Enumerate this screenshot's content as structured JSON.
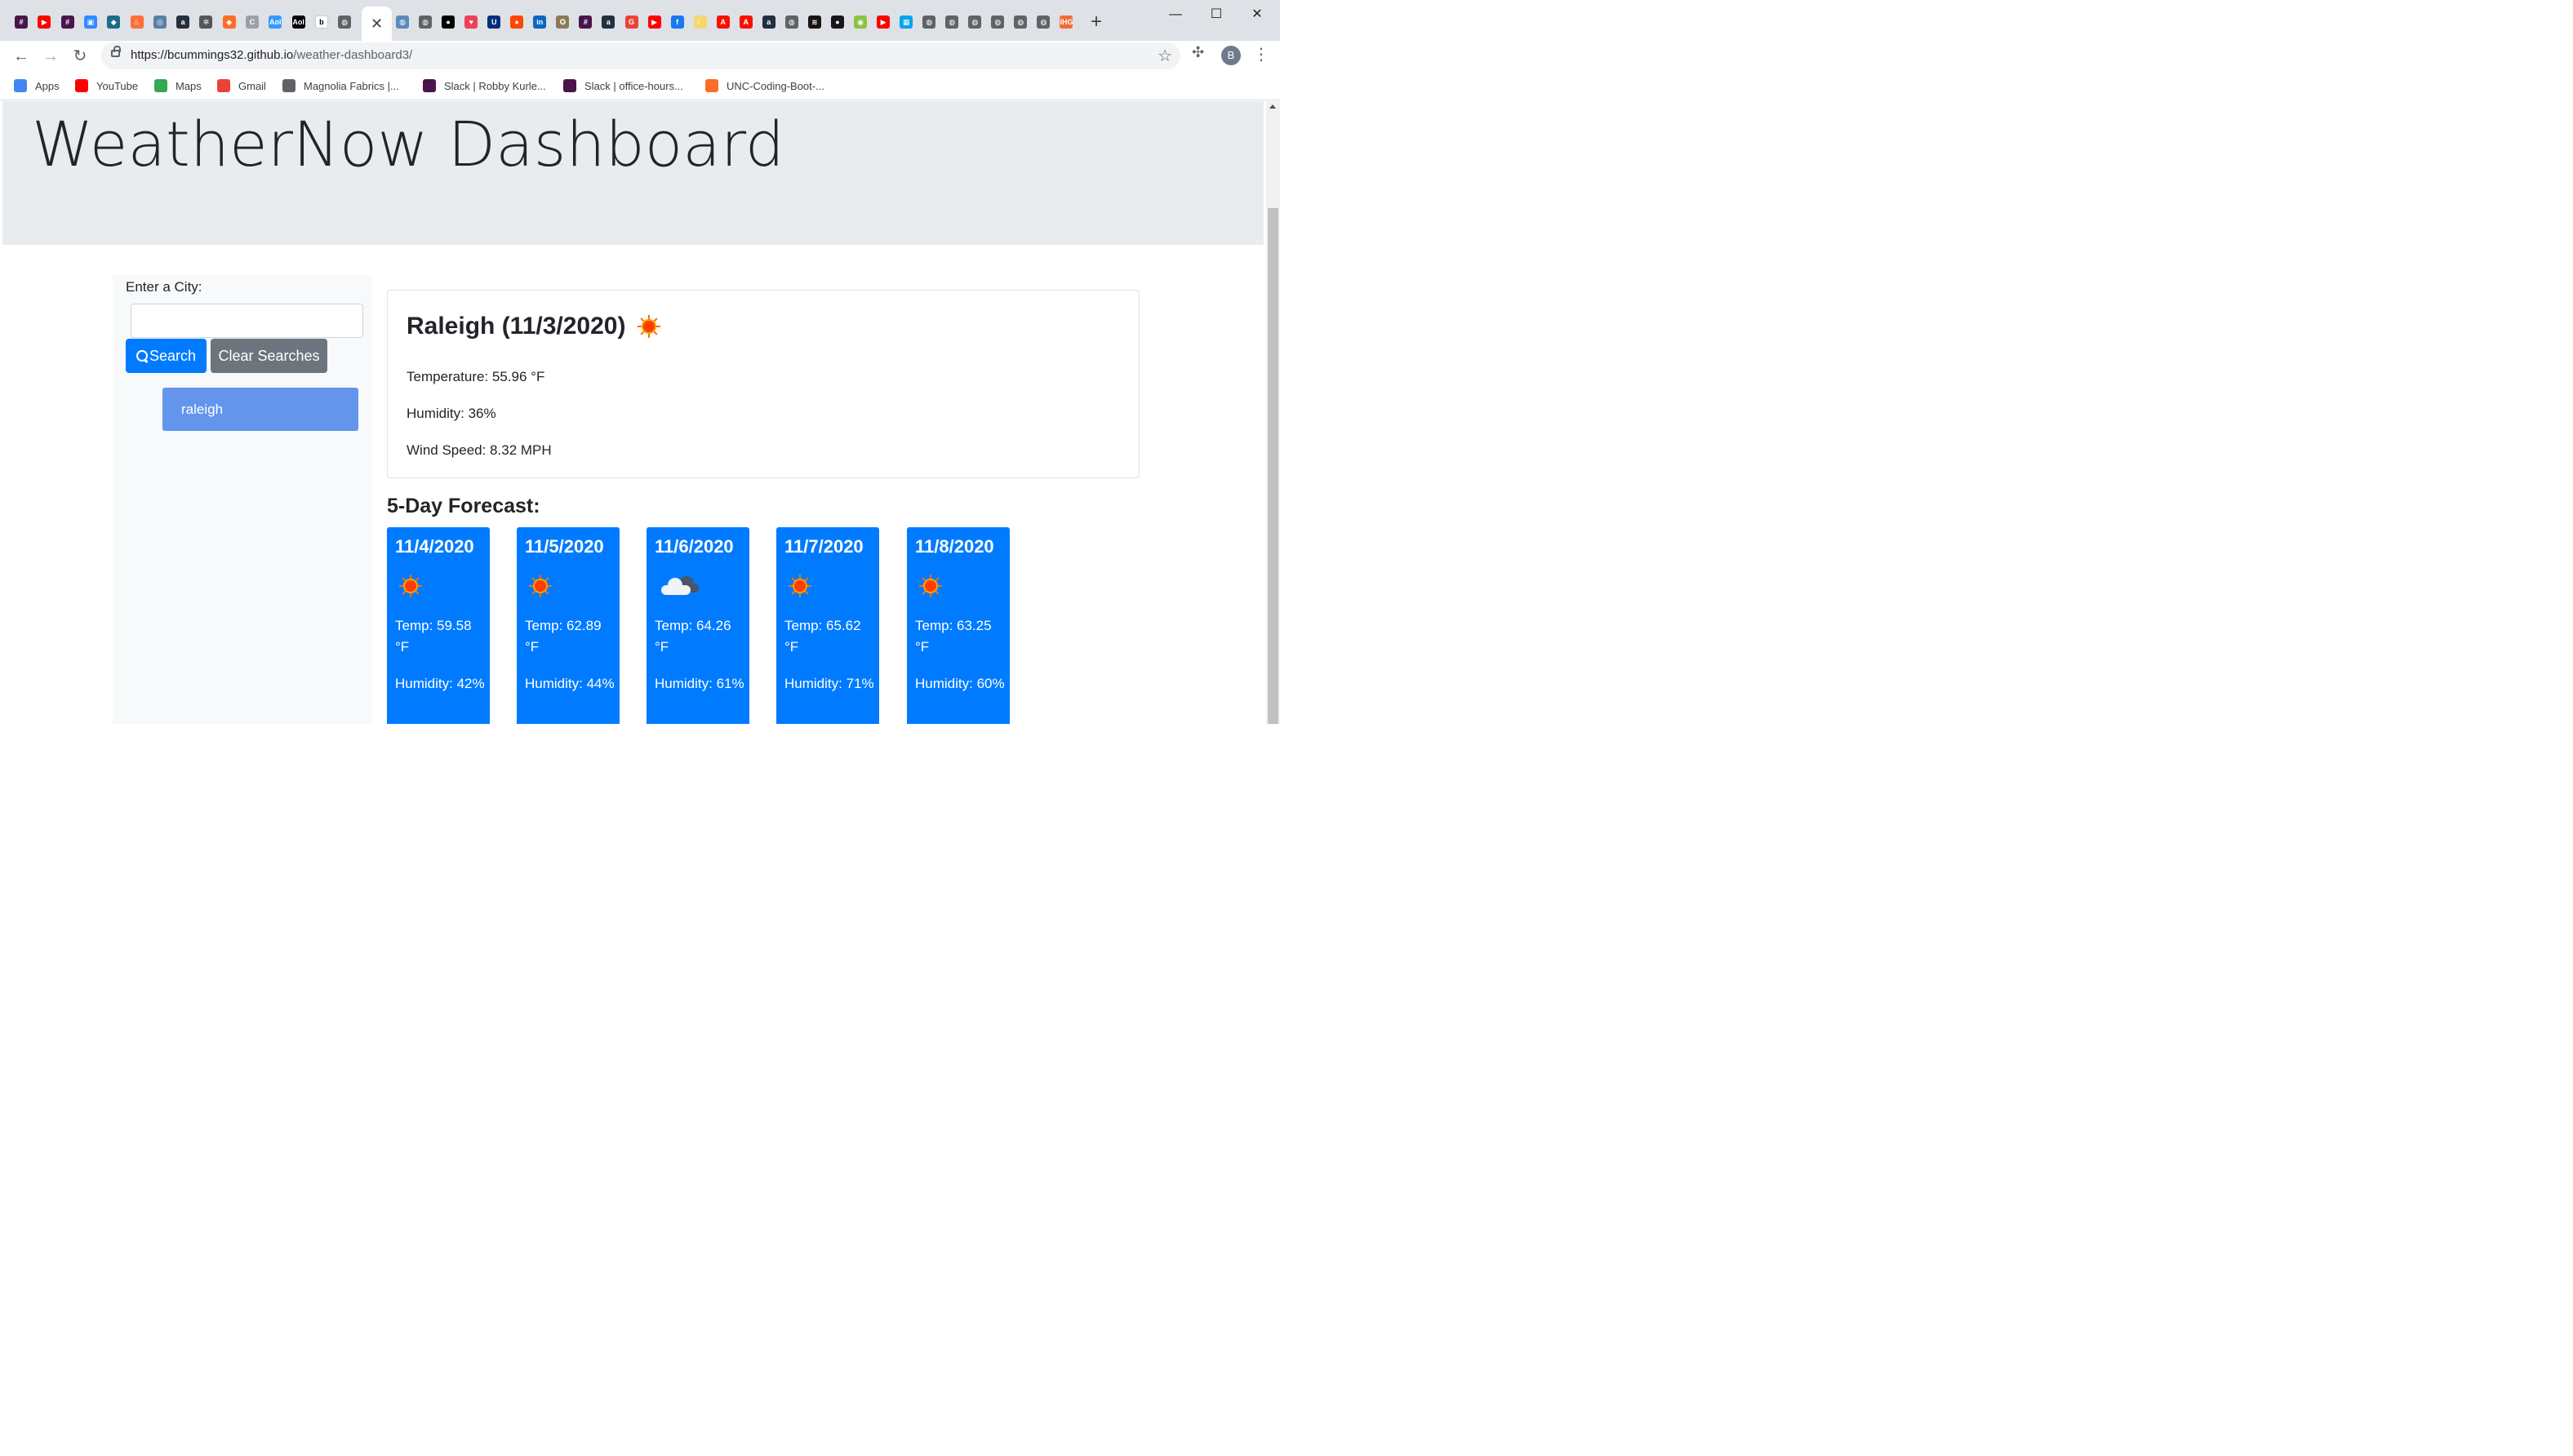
{
  "browser": {
    "tabs": [
      {
        "icon": "slack-icon",
        "color": "#4a154b",
        "glyph": "#"
      },
      {
        "icon": "youtube-icon",
        "color": "#ff0000",
        "glyph": "▶"
      },
      {
        "icon": "slack-icon",
        "color": "#4a154b",
        "glyph": "#"
      },
      {
        "icon": "zoom-icon",
        "color": "#2d8cff",
        "glyph": "▣"
      },
      {
        "icon": "bird-icon",
        "color": "#1b6b8a",
        "glyph": "◆"
      },
      {
        "icon": "flame-icon",
        "color": "#ff6d3a",
        "glyph": "♨"
      },
      {
        "icon": "globe-icon",
        "color": "#5b7ea6",
        "glyph": "◎"
      },
      {
        "icon": "amazon-icon",
        "color": "#232f3e",
        "glyph": "a"
      },
      {
        "icon": "gear-icon",
        "color": "#555555",
        "glyph": "✲"
      },
      {
        "icon": "gitlab-icon",
        "color": "#fc6d26",
        "glyph": "◆"
      },
      {
        "icon": "document-icon",
        "color": "#9aa0a6",
        "glyph": "C"
      },
      {
        "icon": "aol-icon",
        "color": "#3399ff",
        "glyph": "Aol"
      },
      {
        "icon": "aol-icon",
        "color": "#000000",
        "glyph": "Aol"
      },
      {
        "icon": "belk-icon",
        "color": "#ffffff",
        "glyph": "b"
      },
      {
        "icon": "globe-icon",
        "color": "#5f6368",
        "glyph": "◍"
      }
    ],
    "tabs_right": [
      {
        "icon": "globe-icon",
        "color": "#5b8ab8",
        "glyph": "◍"
      },
      {
        "icon": "globe-icon",
        "color": "#5f6368",
        "glyph": "◍"
      },
      {
        "icon": "medium-icon",
        "color": "#000000",
        "glyph": "●"
      },
      {
        "icon": "pocket-icon",
        "color": "#ef4056",
        "glyph": "♥"
      },
      {
        "icon": "shield-icon",
        "color": "#002e7a",
        "glyph": "U"
      },
      {
        "icon": "reddit-icon",
        "color": "#ff4500",
        "glyph": "●"
      },
      {
        "icon": "linkedin-icon",
        "color": "#0a66c2",
        "glyph": "in"
      },
      {
        "icon": "seal-icon",
        "color": "#8a7b55",
        "glyph": "✪"
      },
      {
        "icon": "slack-icon",
        "color": "#4a154b",
        "glyph": "#"
      },
      {
        "icon": "amazon-icon",
        "color": "#232f3e",
        "glyph": "a"
      },
      {
        "icon": "g-icon",
        "color": "#ea4335",
        "glyph": "G"
      },
      {
        "icon": "youtube-icon",
        "color": "#ff0000",
        "glyph": "▶"
      },
      {
        "icon": "facebook-icon",
        "color": "#1877f2",
        "glyph": "f"
      },
      {
        "icon": "moon-icon",
        "color": "#f5d76e",
        "glyph": "☾"
      },
      {
        "icon": "adobe-icon",
        "color": "#fa0f00",
        "glyph": "A"
      },
      {
        "icon": "adobe-icon",
        "color": "#fa0f00",
        "glyph": "A"
      },
      {
        "icon": "amazon-icon",
        "color": "#232f3e",
        "glyph": "a"
      },
      {
        "icon": "globe-icon",
        "color": "#5f6368",
        "glyph": "◍"
      },
      {
        "icon": "spotify-icon",
        "color": "#191414",
        "glyph": "≋"
      },
      {
        "icon": "github-icon",
        "color": "#181717",
        "glyph": "●"
      },
      {
        "icon": "podcast-icon",
        "color": "#8ac541",
        "glyph": "◉"
      },
      {
        "icon": "youtube-icon",
        "color": "#ff0000",
        "glyph": "▶"
      },
      {
        "icon": "microsoft-icon",
        "color": "#00a4ef",
        "glyph": "▦"
      },
      {
        "icon": "globe-icon",
        "color": "#5f6368",
        "glyph": "◍"
      },
      {
        "icon": "globe-icon",
        "color": "#5f6368",
        "glyph": "◍"
      },
      {
        "icon": "globe-icon",
        "color": "#5f6368",
        "glyph": "◍"
      },
      {
        "icon": "globe-icon",
        "color": "#5f6368",
        "glyph": "◍"
      },
      {
        "icon": "globe-icon",
        "color": "#5f6368",
        "glyph": "◍"
      },
      {
        "icon": "globe-icon",
        "color": "#5f6368",
        "glyph": "◍"
      },
      {
        "icon": "ihg-icon",
        "color": "#f26b38",
        "glyph": "IHG"
      }
    ],
    "url_host": "https://bcummings32.github.io",
    "url_path": "/weather-dashboard3/",
    "profile_initial": "B",
    "bookmarks": [
      {
        "label": "Apps",
        "icon": "apps-icon",
        "color": "#4285f4"
      },
      {
        "label": "YouTube",
        "icon": "youtube-icon",
        "color": "#ff0000"
      },
      {
        "label": "Maps",
        "icon": "maps-icon",
        "color": "#34a853"
      },
      {
        "label": "Gmail",
        "icon": "gmail-icon",
        "color": "#ea4335"
      },
      {
        "label": "Magnolia Fabrics |...",
        "icon": "globe-icon",
        "color": "#5f6368"
      },
      {
        "label": "Slack | Robby Kurle...",
        "icon": "slack-icon",
        "color": "#4a154b"
      },
      {
        "label": "Slack | office-hours...",
        "icon": "slack-icon",
        "color": "#4a154b"
      },
      {
        "label": "UNC-Coding-Boot-...",
        "icon": "gitlab-icon",
        "color": "#fc6d26"
      }
    ]
  },
  "page": {
    "title": "WeatherNow Dashboard",
    "sidebar": {
      "city_label": "Enter a City:",
      "city_input_value": "",
      "search_label": "Search",
      "clear_label": "Clear Searches",
      "history": [
        "raleigh"
      ]
    },
    "current": {
      "heading": "Raleigh (11/3/2020)",
      "icon": "sun-icon",
      "temperature": "Temperature: 55.96 °F",
      "humidity": "Humidity: 36%",
      "wind": "Wind Speed: 8.32 MPH"
    },
    "forecast_title": "5-Day Forecast:",
    "forecast": [
      {
        "date": "11/4/2020",
        "icon": "sun-icon",
        "temp": "Temp: 59.58 °F",
        "humidity": "Humidity: 42%"
      },
      {
        "date": "11/5/2020",
        "icon": "sun-icon",
        "temp": "Temp: 62.89 °F",
        "humidity": "Humidity: 44%"
      },
      {
        "date": "11/6/2020",
        "icon": "partly-cloudy-icon",
        "temp": "Temp: 64.26 °F",
        "humidity": "Humidity: 61%"
      },
      {
        "date": "11/7/2020",
        "icon": "sun-icon",
        "temp": "Temp: 65.62 °F",
        "humidity": "Humidity: 71%"
      },
      {
        "date": "11/8/2020",
        "icon": "sun-icon",
        "temp": "Temp: 63.25 °F",
        "humidity": "Humidity: 60%"
      }
    ],
    "colors": {
      "primary": "#007bff",
      "secondary": "#6c757d",
      "history_item": "#6495ed",
      "jumbotron": "#e9ecef"
    }
  }
}
